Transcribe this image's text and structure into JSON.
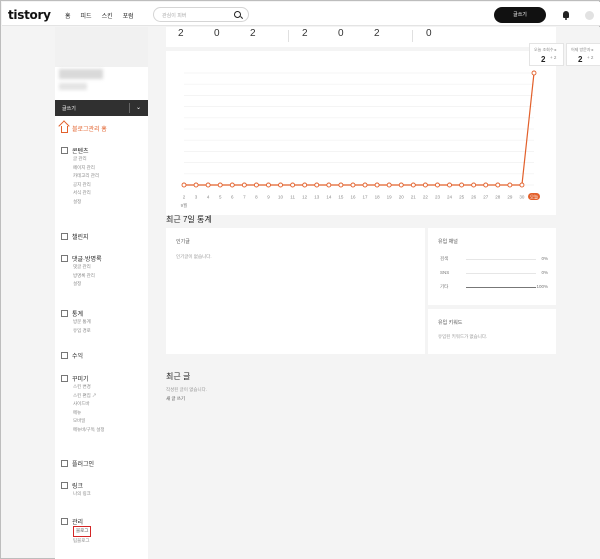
{
  "topbar": {
    "logo": "tistory",
    "nav": [
      "홈",
      "피드",
      "스킨",
      "포럼"
    ],
    "search_placeholder": "관심이 피버",
    "write_label": "글쓰기"
  },
  "sidebar": {
    "write_label": "글쓰기",
    "chevron": "⌄",
    "home_label": "블로그관리 홈",
    "sections": [
      {
        "title": "콘텐츠",
        "items": [
          "글 관리",
          "페이지 관리",
          "카테고리 관리",
          "공지 관리",
          "서식 관리",
          "설정"
        ]
      },
      {
        "title": "챌린지",
        "items": []
      },
      {
        "title": "댓글·방명록",
        "items": [
          "댓글 관리",
          "방명록 관리",
          "설정"
        ]
      },
      {
        "title": "통계",
        "items": [
          "방문 통계",
          "유입 경로"
        ]
      },
      {
        "title": "수익",
        "items": []
      },
      {
        "title": "꾸미기",
        "items": [
          "스킨 변경",
          "스킨 편집 ↗",
          "사이드바",
          "메뉴",
          "모바일",
          "메뉴바/구독 설정"
        ]
      },
      {
        "title": "플러그인",
        "items": []
      },
      {
        "title": "링크",
        "items": [
          "나의 링크"
        ]
      },
      {
        "title": "관리",
        "items": [
          "블로그",
          "팀블로그"
        ]
      }
    ],
    "highlighted_item": "블로그"
  },
  "stats_strip": [
    "2",
    "0",
    "2",
    "2",
    "0",
    "2",
    "0"
  ],
  "mini_stats": [
    {
      "title": "오늘 조회수 ▸",
      "value": "2",
      "delta": "+ 2"
    },
    {
      "title": "어제 방문자 ▸",
      "value": "2",
      "delta": "+ 2"
    }
  ],
  "chart_data": {
    "type": "line",
    "x": [
      "2",
      "3",
      "4",
      "5",
      "6",
      "7",
      "8",
      "9",
      "10",
      "11",
      "12",
      "13",
      "14",
      "15",
      "16",
      "17",
      "18",
      "19",
      "20",
      "21",
      "22",
      "23",
      "24",
      "25",
      "26",
      "27",
      "28",
      "29",
      "30",
      "오늘"
    ],
    "x_sub": "9월",
    "series": [
      {
        "values": [
          0,
          0,
          0,
          0,
          0,
          0,
          0,
          0,
          0,
          0,
          0,
          0,
          0,
          0,
          0,
          0,
          0,
          0,
          0,
          0,
          0,
          0,
          0,
          0,
          0,
          0,
          0,
          0,
          0,
          2
        ]
      }
    ],
    "ylim": [
      0,
      2
    ],
    "grid": true,
    "color": "#e2602b"
  },
  "weekly": {
    "title": "최근 7일 통계",
    "popular": {
      "title": "인기글",
      "empty": "인기글이 없습니다."
    },
    "inflow": {
      "title": "유입 채널",
      "rows": [
        {
          "label": "검색",
          "pct": "0%",
          "fill": 0
        },
        {
          "label": "SNS",
          "pct": "0%",
          "fill": 0
        },
        {
          "label": "기타",
          "pct": "100%",
          "fill": 1
        }
      ]
    },
    "keywords": {
      "title": "유입 키워드",
      "empty": "유입된 키워드가 없습니다."
    }
  },
  "recent": {
    "title": "최근 글",
    "empty": "작성된 글이 없습니다.",
    "new_link": "새 글 쓰기"
  }
}
